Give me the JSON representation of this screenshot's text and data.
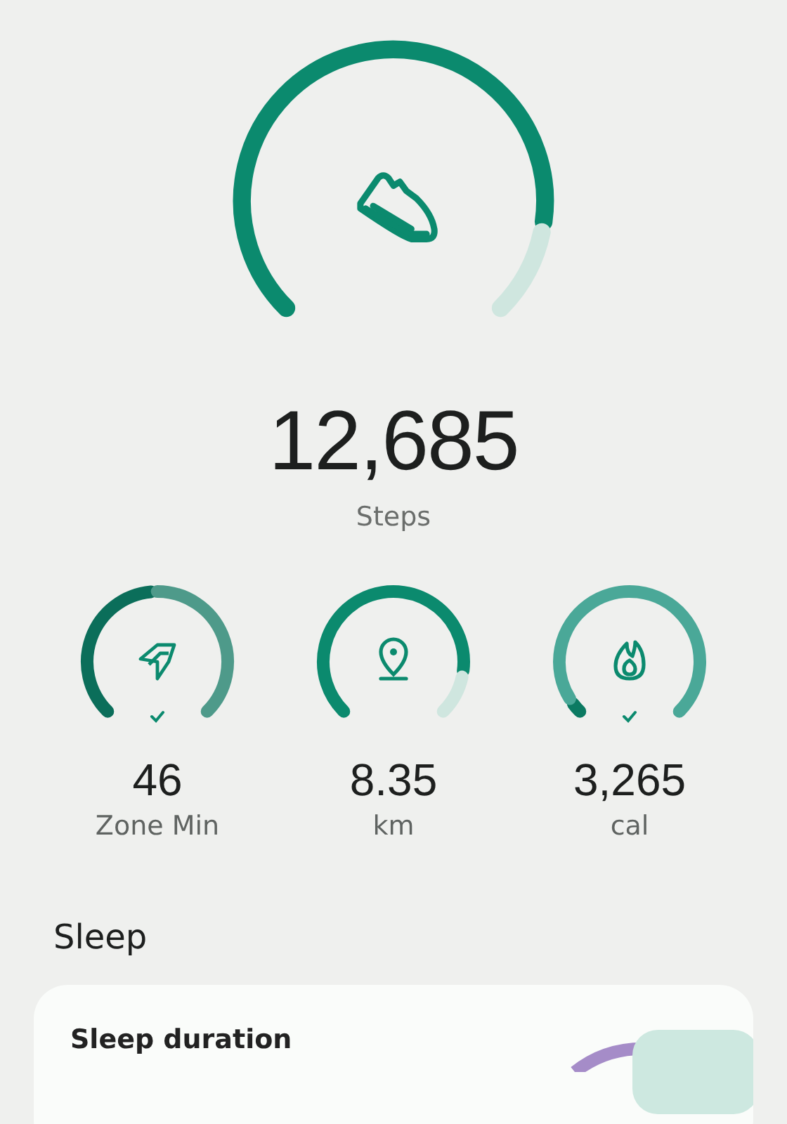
{
  "steps": {
    "value": "12,685",
    "label": "Steps"
  },
  "metrics": [
    {
      "kind": "zone",
      "value": "46",
      "label": "Zone Min",
      "goal_met": true
    },
    {
      "kind": "distance",
      "value": "8.35",
      "label": "km",
      "goal_met": false
    },
    {
      "kind": "calories",
      "value": "3,265",
      "label": "cal",
      "goal_met": true
    }
  ],
  "sleep": {
    "heading": "Sleep",
    "card_title": "Sleep duration"
  }
}
